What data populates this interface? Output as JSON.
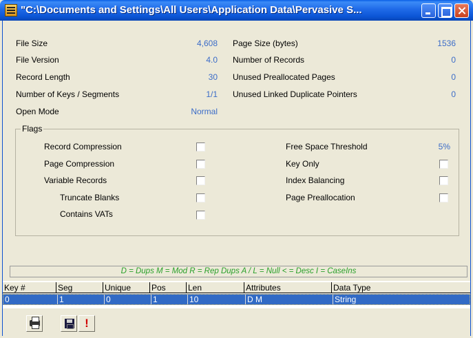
{
  "window": {
    "title": "\"C:\\Documents and Settings\\All Users\\Application Data\\Pervasive S..."
  },
  "stats_left": [
    {
      "label": "File Size",
      "value": "4,608"
    },
    {
      "label": "File Version",
      "value": "4.0"
    },
    {
      "label": "Record Length",
      "value": "30"
    },
    {
      "label": "Number of Keys / Segments",
      "value": "1/1"
    },
    {
      "label": "Open Mode",
      "value": "Normal"
    }
  ],
  "stats_right": [
    {
      "label": "Page Size (bytes)",
      "value": "1536"
    },
    {
      "label": "Number of Records",
      "value": "0"
    },
    {
      "label": "Unused Preallocated Pages",
      "value": "0"
    },
    {
      "label": "Unused Linked Duplicate Pointers",
      "value": "0"
    }
  ],
  "flags": {
    "title": "Flags",
    "left": [
      {
        "label": "Record Compression",
        "checked": false
      },
      {
        "label": "Page Compression",
        "checked": false
      },
      {
        "label": "Variable Records",
        "checked": false
      },
      {
        "label": "Truncate Blanks",
        "checked": false
      },
      {
        "label": "Contains VATs",
        "checked": false
      }
    ],
    "free_space_label": "Free Space Threshold",
    "free_space_value": "5%",
    "right": [
      {
        "label": "Key Only",
        "checked": false
      },
      {
        "label": "Index Balancing",
        "checked": false
      },
      {
        "label": "Page Preallocation",
        "checked": false
      }
    ]
  },
  "legend": "D = Dups   M = Mod   R = Rep Dups   A / L = Null   < = Desc   I = CaseIns",
  "grid": {
    "columns": [
      "Key #",
      "Seg",
      "Unique",
      "Pos",
      "Len",
      "Attributes",
      "Data Type"
    ],
    "rows": [
      [
        "0",
        "1",
        "0",
        "1",
        "10",
        "D M",
        "String"
      ]
    ]
  },
  "toolbar": {
    "print_icon": "printer-icon",
    "save_icon": "floppy-disk-icon",
    "alert_label": "!"
  },
  "colors": {
    "value_text": "#3b6cc8",
    "legend_text": "#2aa02a",
    "selection": "#316ac5",
    "title_bar": "#0b55d6"
  }
}
